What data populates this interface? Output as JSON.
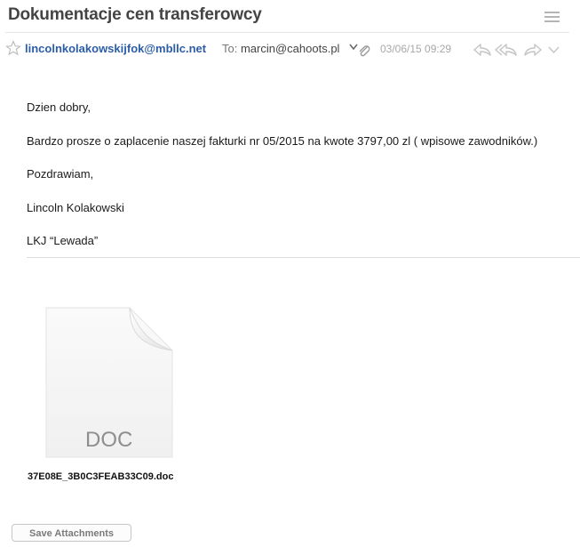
{
  "message": {
    "subject": "Dokumentacje cen transferowcy",
    "sender": "lincolnkolakowskijfok@mbllc.net",
    "to_label": "To:",
    "to_address": "marcin@cahoots.pl",
    "date": "03/06/15 09:29"
  },
  "body": {
    "lines": [
      "Dzien dobry,",
      "Bardzo prosze o zaplacenie naszej fakturki nr 05/2015 na kwote 3797,00 zl ( wpisowe zawodników.)",
      "Pozdrawiam,",
      "Lincoln Kolakowski",
      "LKJ “Lewada”"
    ]
  },
  "attachment": {
    "type_label": "DOC",
    "filename": "37E08E_3B0C3FEAB33C09.doc",
    "save_label": "Save Attachments"
  },
  "icons": [
    "menu-icon",
    "star-icon",
    "chevron-down-icon",
    "paperclip-icon",
    "reply-icon",
    "reply-all-icon",
    "forward-icon",
    "more-chevron-icon",
    "document-icon"
  ],
  "colors": {
    "sender": "#2c5da8",
    "subject": "#444444",
    "muted": "#a8a8a8"
  }
}
